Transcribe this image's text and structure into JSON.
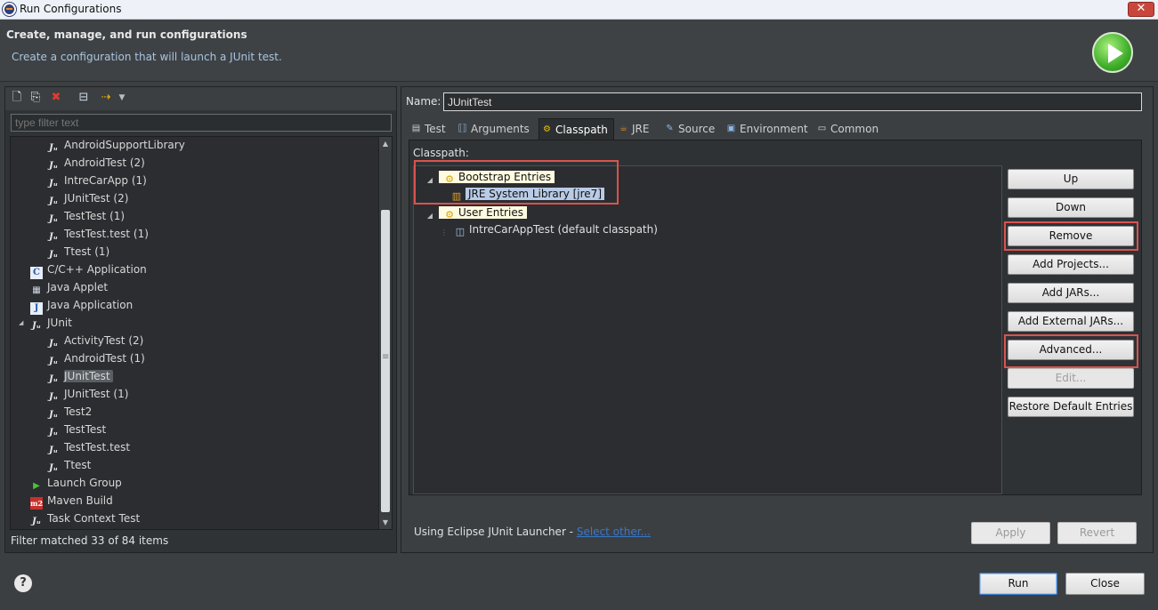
{
  "window": {
    "title": "Run Configurations"
  },
  "header": {
    "title": "Create, manage, and run configurations",
    "subtitle": "Create a configuration that will launch a JUnit test."
  },
  "left": {
    "filter_placeholder": "type filter text",
    "tree": [
      {
        "label": "AndroidSupportLibrary",
        "level": 2,
        "icon": "junit-icon"
      },
      {
        "label": "AndroidTest (2)",
        "level": 2,
        "icon": "junit-icon"
      },
      {
        "label": "IntreCarApp (1)",
        "level": 2,
        "icon": "junit-icon"
      },
      {
        "label": "JUnitTest (2)",
        "level": 2,
        "icon": "junit-icon"
      },
      {
        "label": "TestTest (1)",
        "level": 2,
        "icon": "junit-icon"
      },
      {
        "label": "TestTest.test (1)",
        "level": 2,
        "icon": "junit-icon"
      },
      {
        "label": "Ttest (1)",
        "level": 2,
        "icon": "junit-icon"
      },
      {
        "label": "C/C++ Application",
        "level": 1,
        "icon": "cpp-app-icon"
      },
      {
        "label": "Java Applet",
        "level": 1,
        "icon": "java-applet-icon"
      },
      {
        "label": "Java Application",
        "level": 1,
        "icon": "java-app-icon"
      },
      {
        "label": "JUnit",
        "level": 1,
        "icon": "junit-icon",
        "expanded": true
      },
      {
        "label": "ActivityTest (2)",
        "level": 2,
        "icon": "junit-icon"
      },
      {
        "label": "AndroidTest (1)",
        "level": 2,
        "icon": "junit-icon"
      },
      {
        "label": "JUnitTest",
        "level": 2,
        "icon": "junit-icon",
        "selected": true
      },
      {
        "label": "JUnitTest (1)",
        "level": 2,
        "icon": "junit-icon"
      },
      {
        "label": "Test2",
        "level": 2,
        "icon": "junit-icon"
      },
      {
        "label": "TestTest",
        "level": 2,
        "icon": "junit-icon"
      },
      {
        "label": "TestTest.test",
        "level": 2,
        "icon": "junit-icon"
      },
      {
        "label": "Ttest",
        "level": 2,
        "icon": "junit-icon"
      },
      {
        "label": "Launch Group",
        "level": 1,
        "icon": "launch-group-icon"
      },
      {
        "label": "Maven Build",
        "level": 1,
        "icon": "maven-icon"
      },
      {
        "label": "Task Context Test",
        "level": 1,
        "icon": "task-context-icon"
      }
    ],
    "status": "Filter matched 33 of 84 items"
  },
  "right": {
    "name_label": "Name:",
    "name_value": "JUnitTest",
    "tabs": [
      {
        "label": "Test",
        "icon": "test-tab-icon"
      },
      {
        "label": "Arguments",
        "icon": "arguments-tab-icon"
      },
      {
        "label": "Classpath",
        "icon": "classpath-tab-icon",
        "active": true
      },
      {
        "label": "JRE",
        "icon": "jre-tab-icon"
      },
      {
        "label": "Source",
        "icon": "source-tab-icon"
      },
      {
        "label": "Environment",
        "icon": "environment-tab-icon"
      },
      {
        "label": "Common",
        "icon": "common-tab-icon"
      }
    ],
    "classpath_label": "Classpath:",
    "classpath_tree": {
      "bootstrap": "Bootstrap Entries",
      "jre_lib": "JRE System Library [jre7]",
      "user": "User Entries",
      "project": "IntreCarAppTest (default classpath)"
    },
    "buttons": {
      "up": "Up",
      "down": "Down",
      "remove": "Remove",
      "add_projects": "Add Projects...",
      "add_jars": "Add JARs...",
      "add_external_jars": "Add External JARs...",
      "advanced": "Advanced...",
      "edit": "Edit...",
      "restore": "Restore Default Entries"
    },
    "launcher_text": "Using Eclipse JUnit Launcher - ",
    "launcher_link": "Select other...",
    "apply": "Apply",
    "revert": "Revert"
  },
  "footer": {
    "run": "Run",
    "close": "Close"
  },
  "colors": {
    "highlight_box": "#d9534f",
    "link": "#3a77c8"
  }
}
